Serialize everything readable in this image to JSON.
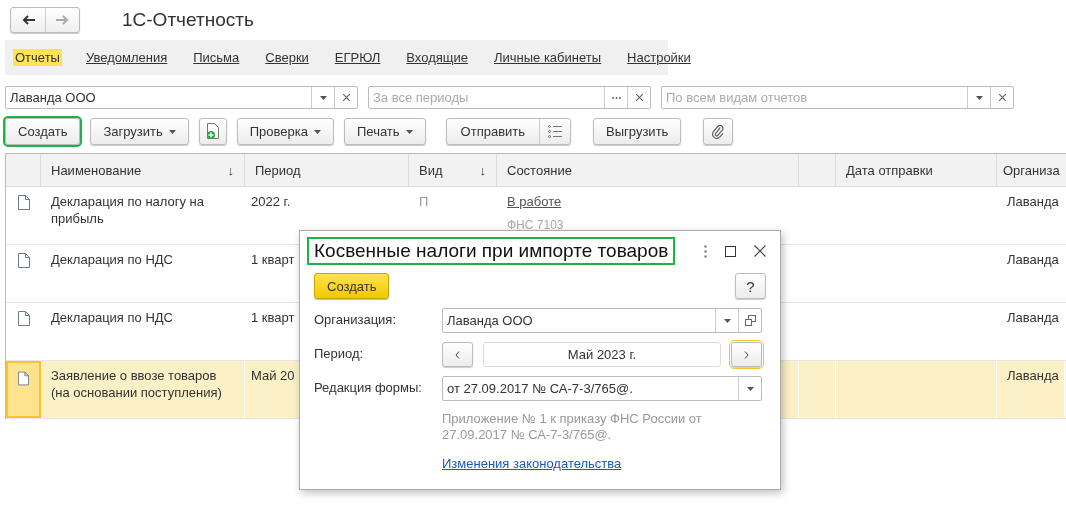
{
  "window": {
    "title": "1С-Отчетность"
  },
  "nav_tabs": [
    {
      "label": "Отчеты",
      "selected": true
    },
    {
      "label": "Уведомления",
      "selected": false
    },
    {
      "label": "Письма",
      "selected": false
    },
    {
      "label": "Сверки",
      "selected": false
    },
    {
      "label": "ЕГРЮЛ",
      "selected": false
    },
    {
      "label": "Входящие",
      "selected": false
    },
    {
      "label": "Личные кабинеты",
      "selected": false
    },
    {
      "label": "Настройки",
      "selected": false
    }
  ],
  "filters": [
    {
      "kind": "select",
      "value": "Лаванда ООО"
    },
    {
      "kind": "choice",
      "placeholder": "За все периоды"
    },
    {
      "kind": "select",
      "placeholder": "По всем видам отчетов"
    }
  ],
  "toolbar": [
    {
      "kind": "button",
      "label": "Создать"
    },
    {
      "kind": "menu",
      "label": "Загрузить"
    },
    {
      "kind": "add-file"
    },
    {
      "kind": "menu",
      "label": "Проверка"
    },
    {
      "kind": "menu",
      "label": "Печать"
    },
    {
      "kind": "split",
      "label": "Отправить"
    },
    {
      "kind": "button",
      "label": "Выгрузить"
    },
    {
      "kind": "attach"
    }
  ],
  "table": {
    "columns": [
      {
        "label": "Наименование",
        "sort_mark": "↓"
      },
      {
        "label": "Период"
      },
      {
        "label": "Вид",
        "sort_mark": "↓"
      },
      {
        "label": "Состояние"
      },
      {},
      {
        "label": "Дата отправки"
      },
      {
        "label": "Организа"
      }
    ],
    "rows": [
      {
        "name": "Декларация по налогу на прибыль",
        "period": "2022 г.",
        "type": "П",
        "status": "В работе",
        "status_note": "ФНС 7103",
        "organization": "Лаванда",
        "selected": false
      },
      {
        "name": "Декларация по НДС",
        "period": "1 кварт",
        "organization": "Лаванда",
        "selected": false
      },
      {
        "name": "Декларация по НДС",
        "period": "1 кварт",
        "organization": "Лаванда",
        "selected": false
      },
      {
        "name": "Заявление о ввозе товаров (на основании поступления)",
        "period": "Май 20",
        "organization": "Лаванда",
        "selected": true
      }
    ]
  },
  "dialog": {
    "title": "Косвенные налоги при импорте товаров",
    "create_button": "Создать",
    "help_button": "?",
    "fields": [
      {
        "kind": "select",
        "label": "Организация:",
        "value": "Лаванда ООО"
      },
      {
        "kind": "period",
        "label": "Период:",
        "value": "Май 2023 г."
      },
      {
        "kind": "dropdown",
        "label": "Редакция формы:",
        "value": "от 27.09.2017 № СА-7-3/765@."
      }
    ],
    "note": "Приложение № 1 к приказу ФНС России от 27.09.2017 № СА-7-3/765@.",
    "link": "Изменения законодательства"
  }
}
